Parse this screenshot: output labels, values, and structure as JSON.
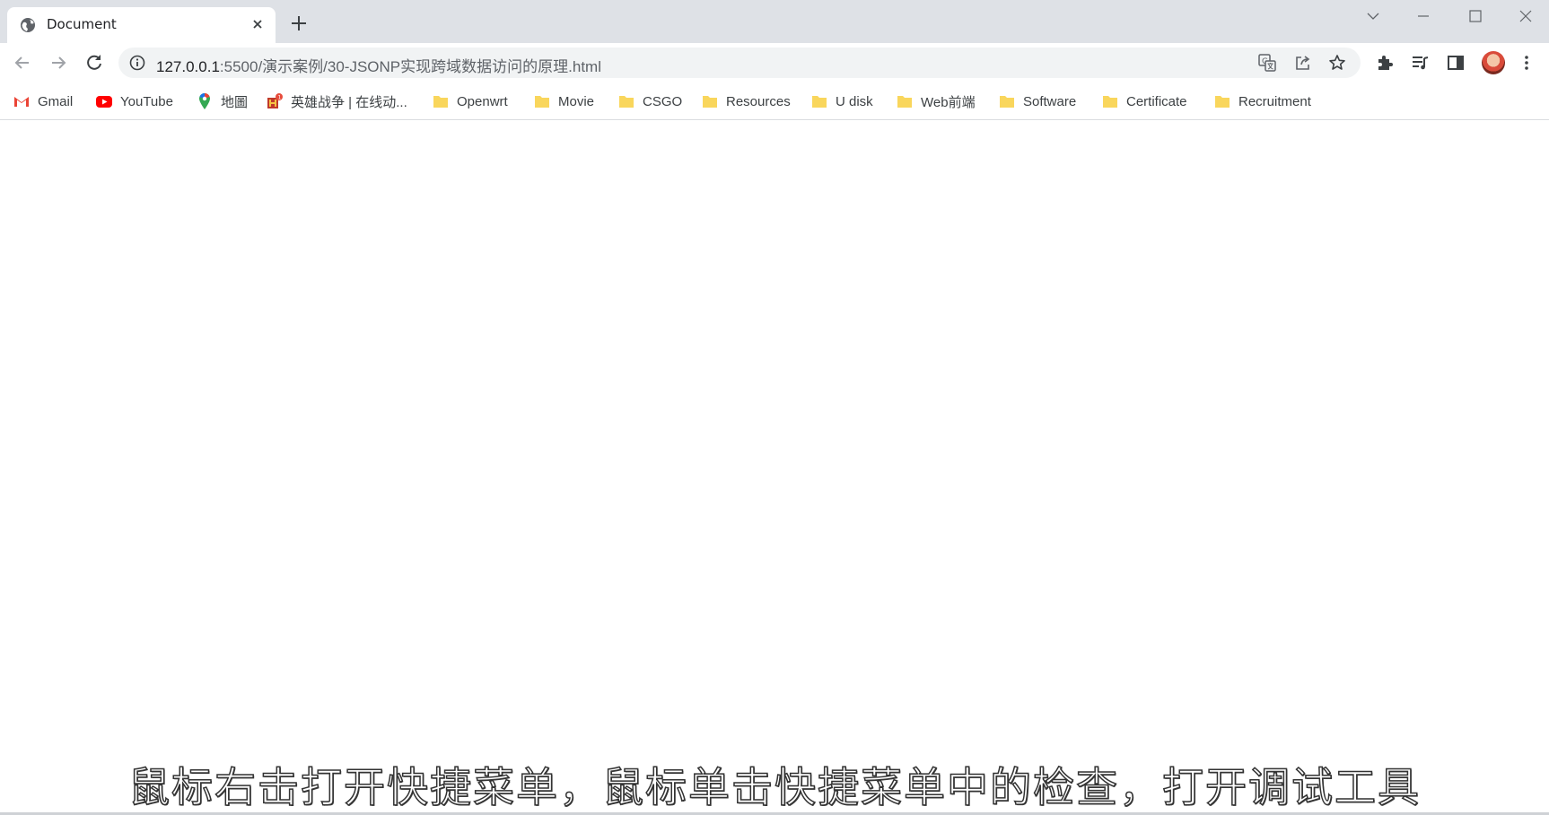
{
  "tab": {
    "title": "Document",
    "favicon": "globe-icon",
    "close_icon": "close-icon",
    "new_tab_icon": "plus-icon"
  },
  "window_controls": [
    "chevron-down-icon",
    "minimize-icon",
    "maximize-icon",
    "close-icon"
  ],
  "toolbar": {
    "back_icon": "arrow-left-icon",
    "forward_icon": "arrow-right-icon",
    "reload_icon": "reload-icon",
    "url_host": "127.0.0.1",
    "url_rest": ":5500/演示案例/30-JSONP实现跨域数据访问的原理.html",
    "site_info_icon": "info-icon",
    "translate_icon": "translate-icon",
    "share_icon": "share-icon",
    "bookmark_star_icon": "star-icon",
    "extensions_icon": "puzzle-icon",
    "media_icon": "media-queue-icon",
    "side_panel_icon": "side-panel-icon"
  },
  "bookmarks": [
    {
      "label": "Gmail",
      "icon": "gmail-icon"
    },
    {
      "label": "YouTube",
      "icon": "youtube-icon"
    },
    {
      "label": "地圖",
      "icon": "maps-pin-icon"
    },
    {
      "label": "英雄战争 | 在线动...",
      "icon": "game-icon"
    },
    {
      "label": "Openwrt",
      "icon": "folder-icon"
    },
    {
      "label": "Movie",
      "icon": "folder-icon"
    },
    {
      "label": "CSGO",
      "icon": "folder-icon"
    },
    {
      "label": "Resources",
      "icon": "folder-icon"
    },
    {
      "label": "U disk",
      "icon": "folder-icon"
    },
    {
      "label": "Web前端",
      "icon": "folder-icon"
    },
    {
      "label": "Software",
      "icon": "folder-icon"
    },
    {
      "label": "Certificate",
      "icon": "folder-icon"
    },
    {
      "label": "Recruitment",
      "icon": "folder-icon"
    }
  ],
  "subtitle": "鼠标右击打开快捷菜单，鼠标单击快捷菜单中的检查，打开调试工具",
  "colors": {
    "tabstrip": "#dee1e6",
    "omnibox": "#f1f3f4",
    "folder": "#f9d65c",
    "youtube": "#ff0000",
    "gmail": "#ea4335"
  }
}
